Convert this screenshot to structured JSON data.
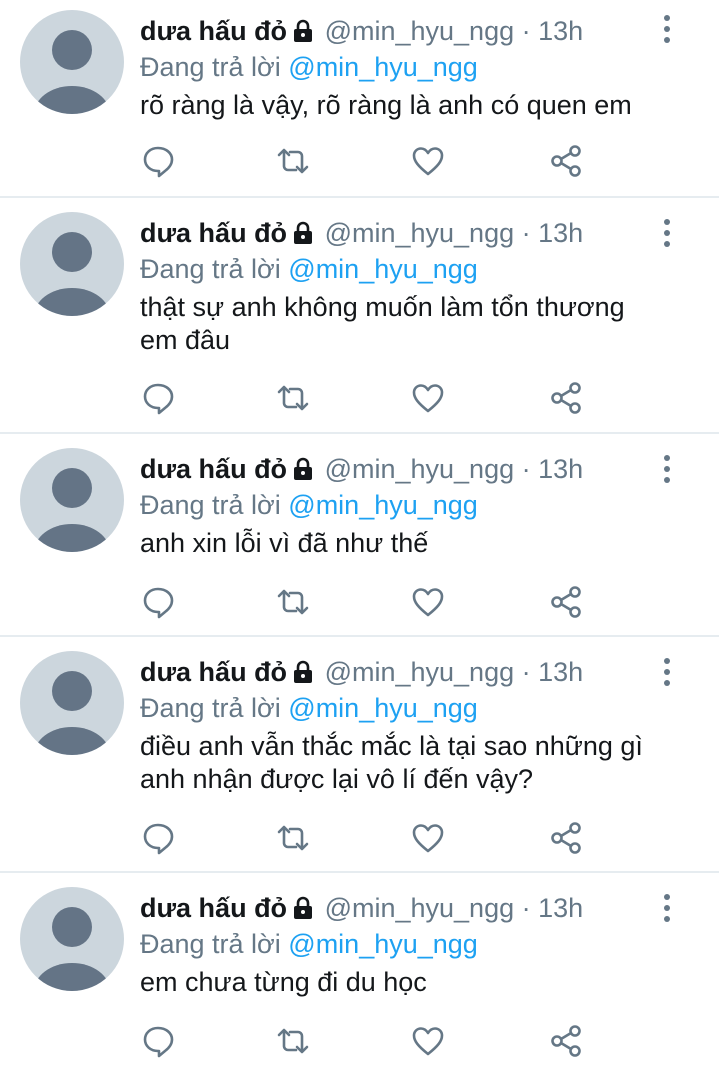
{
  "colors": {
    "name": "#14171a",
    "muted": "#657786",
    "mention": "#1da1f2",
    "divider": "#e6ecf0",
    "avatar_bg": "#ccd6dd",
    "avatar_fg": "#647486"
  },
  "tweets": [
    {
      "name": "dưa hấu đỏ",
      "handle": "@min_hyu_ngg",
      "separator": "·",
      "time": "13h",
      "replying_label": "Đang trả lời",
      "replying_to": "@min_hyu_ngg",
      "text": "rõ ràng là vậy, rõ ràng là anh có quen em"
    },
    {
      "name": "dưa hấu đỏ",
      "handle": "@min_hyu_ngg",
      "separator": "·",
      "time": "13h",
      "replying_label": "Đang trả lời",
      "replying_to": "@min_hyu_ngg",
      "text": "thật sự anh không muốn làm tổn thương em đâu"
    },
    {
      "name": "dưa hấu đỏ",
      "handle": "@min_hyu_ngg",
      "separator": "·",
      "time": "13h",
      "replying_label": "Đang trả lời",
      "replying_to": "@min_hyu_ngg",
      "text": "anh xin lỗi vì đã như thế"
    },
    {
      "name": "dưa hấu đỏ",
      "handle": "@min_hyu_ngg",
      "separator": "·",
      "time": "13h",
      "replying_label": "Đang trả lời",
      "replying_to": "@min_hyu_ngg",
      "text": "điều anh vẫn thắc mắc là tại sao những gì anh nhận được lại vô lí đến vậy?"
    },
    {
      "name": "dưa hấu đỏ",
      "handle": "@min_hyu_ngg",
      "separator": "·",
      "time": "13h",
      "replying_label": "Đang trả lời",
      "replying_to": "@min_hyu_ngg",
      "text": "em chưa từng đi du học"
    }
  ],
  "icons": {
    "lock": "lock-icon",
    "more": "more-vertical-icon",
    "reply": "reply-icon",
    "retweet": "retweet-icon",
    "like": "heart-icon",
    "share": "share-icon"
  }
}
